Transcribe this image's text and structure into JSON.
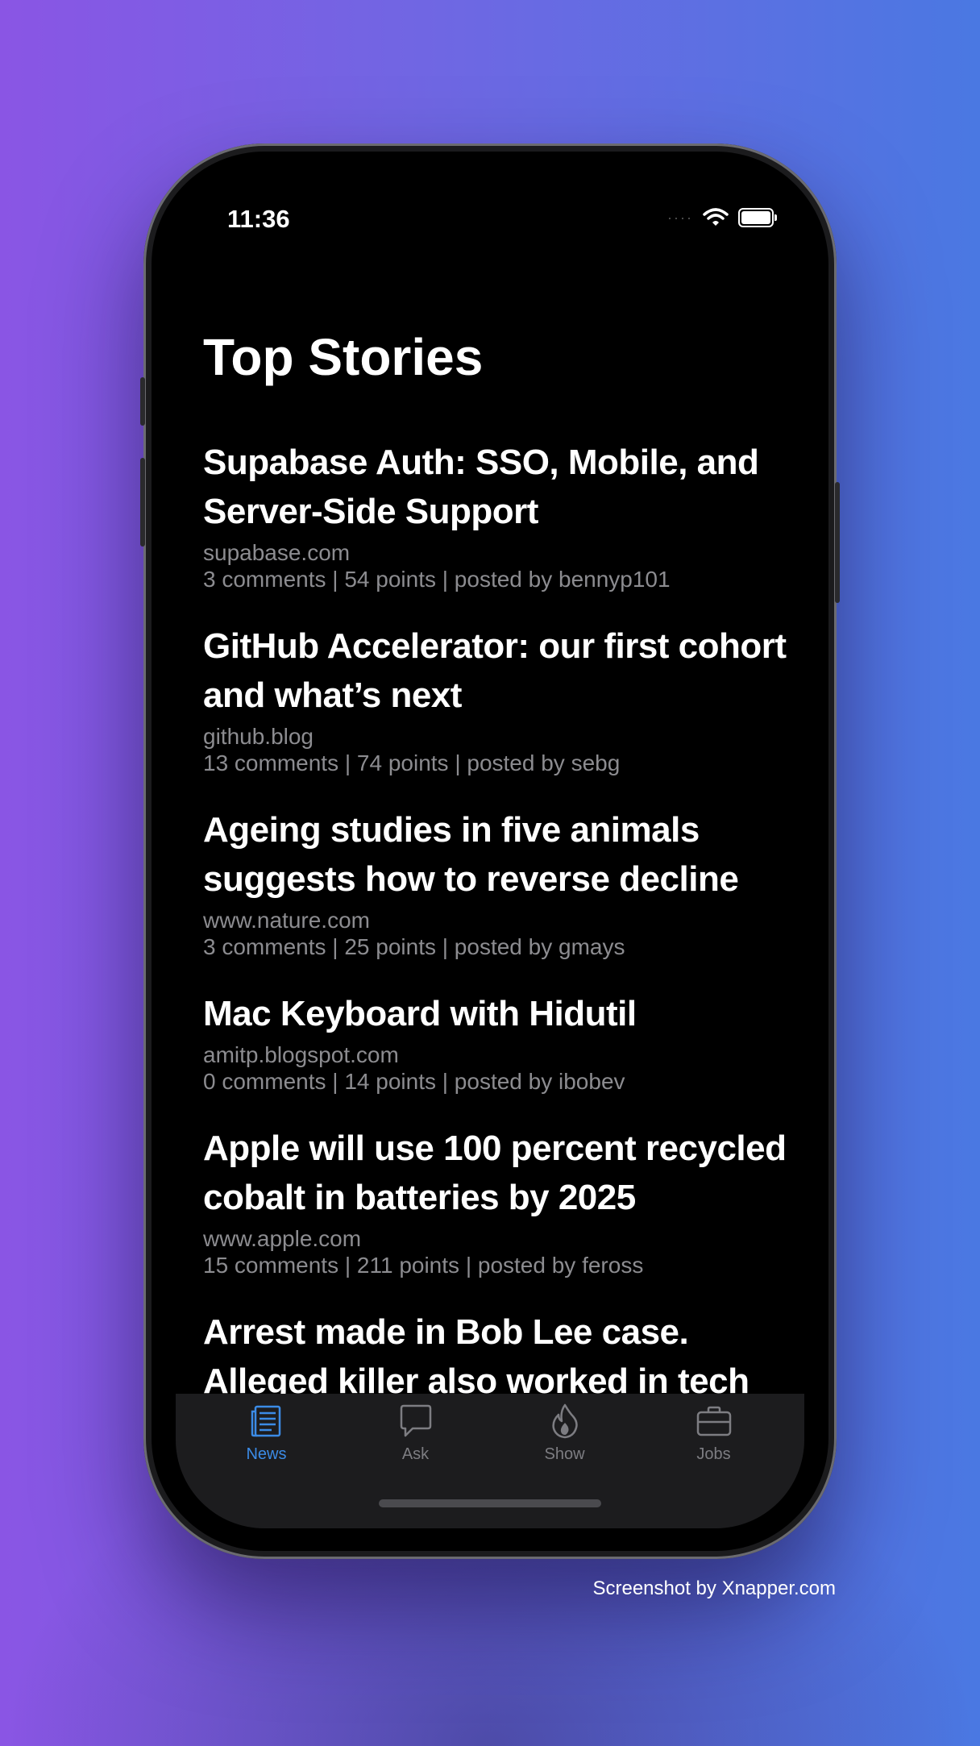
{
  "status_bar": {
    "time": "11:36"
  },
  "page": {
    "title": "Top Stories"
  },
  "stories": [
    {
      "title": "Supabase Auth: SSO, Mobile, and Server-Side Support",
      "domain": "supabase.com",
      "meta": "3 comments | 54 points | posted by bennyp101"
    },
    {
      "title": "GitHub Accelerator: our first cohort and what’s next",
      "domain": "github.blog",
      "meta": "13 comments | 74 points | posted by sebg"
    },
    {
      "title": "Ageing studies in five animals suggests how to reverse decline",
      "domain": "www.nature.com",
      "meta": "3 comments | 25 points | posted by gmays"
    },
    {
      "title": "Mac Keyboard with Hidutil",
      "domain": "amitp.blogspot.com",
      "meta": "0 comments | 14 points | posted by ibobev"
    },
    {
      "title": "Apple will use 100 percent recycled cobalt in batteries by 2025",
      "domain": "www.apple.com",
      "meta": "15 comments | 211 points | posted by feross"
    },
    {
      "title": "Arrest made in Bob Lee case. Alleged killer also worked in tech",
      "domain": "",
      "meta": ""
    }
  ],
  "tab_bar": {
    "tabs": [
      {
        "label": "News",
        "icon": "newspaper-icon",
        "active": true
      },
      {
        "label": "Ask",
        "icon": "chat-bubble-icon",
        "active": false
      },
      {
        "label": "Show",
        "icon": "flame-icon",
        "active": false
      },
      {
        "label": "Jobs",
        "icon": "briefcase-icon",
        "active": false
      }
    ]
  },
  "colors": {
    "accent": "#3b8be6",
    "inactive": "#7d7d82",
    "background": "#000000"
  },
  "footer": {
    "credit": "Screenshot by Xnapper.com"
  }
}
